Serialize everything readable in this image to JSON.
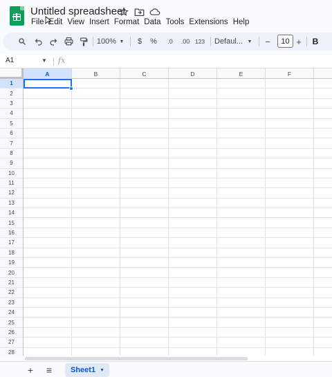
{
  "app": {
    "doc_title": "Untitled spreadsheet",
    "menus": [
      "File",
      "Edit",
      "View",
      "Insert",
      "Format",
      "Data",
      "Tools",
      "Extensions",
      "Help"
    ]
  },
  "toolbar": {
    "zoom": "100%",
    "currency": "$",
    "percent": "%",
    "dec_decrease": ".0",
    "dec_increase": ".00",
    "number_format": "123",
    "font_family": "Defaul...",
    "minus": "−",
    "font_size": "10",
    "plus": "+",
    "bold": "B"
  },
  "formula_bar": {
    "name_box": "A1",
    "fx": "fx"
  },
  "grid": {
    "columns": [
      "A",
      "B",
      "C",
      "D",
      "E",
      "F"
    ],
    "rows": [
      "1",
      "2",
      "3",
      "4",
      "5",
      "6",
      "7",
      "8",
      "9",
      "10",
      "11",
      "12",
      "13",
      "14",
      "15",
      "16",
      "17",
      "18",
      "19",
      "20",
      "21",
      "22",
      "23",
      "24",
      "25",
      "26",
      "27",
      "28"
    ],
    "selected_cell": "A1"
  },
  "sheets": {
    "add": "+",
    "list": "≡",
    "tabs": [
      "Sheet1"
    ]
  }
}
